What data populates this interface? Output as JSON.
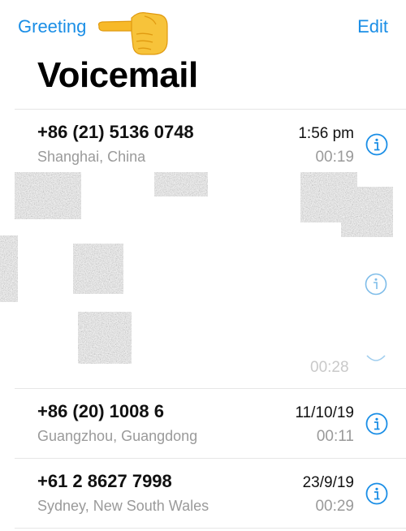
{
  "nav": {
    "left_label": "Greeting",
    "right_label": "Edit"
  },
  "title": "Voicemail",
  "icons": {
    "pointing": "backhand-index-pointing-right-icon",
    "info": "info-circle-icon"
  },
  "colors": {
    "accent": "#1a8ee6",
    "secondary_text": "#9a9a9a",
    "divider": "#e6e6e6"
  },
  "voicemails": [
    {
      "number": "+86 (21) 5136 0748",
      "location": "Shanghai, China",
      "when": "1:56 pm",
      "duration": "00:19"
    },
    {
      "number": "+86 (20) 1008 6",
      "location": "Guangzhou, Guangdong",
      "when": "11/10/19",
      "duration": "00:11"
    },
    {
      "number": "+61 2 8627 7998",
      "location": "Sydney, New South Wales",
      "when": "23/9/19",
      "duration": "00:29"
    }
  ],
  "partially_visible_duration": "00:28"
}
